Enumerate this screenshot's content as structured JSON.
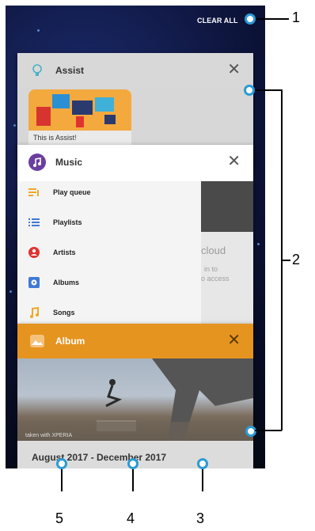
{
  "header": {
    "clear_all_label": "CLEAR ALL"
  },
  "cards": {
    "assist": {
      "title": "Assist",
      "icon": "lightbulb-icon",
      "close_icon": "close-icon",
      "preview_caption": "This is Assist!"
    },
    "music": {
      "title": "Music",
      "icon": "music-note-icon",
      "close_icon": "close-icon",
      "menu": [
        {
          "label": "Play queue",
          "icon": "queue-icon",
          "color": "#f2a626"
        },
        {
          "label": "Playlists",
          "icon": "list-icon",
          "color": "#3f7ad6"
        },
        {
          "label": "Artists",
          "icon": "artist-icon",
          "color": "#e0322f"
        },
        {
          "label": "Albums",
          "icon": "album-icon",
          "color": "#3f7ad6"
        },
        {
          "label": "Songs",
          "icon": "song-icon",
          "color": "#f2a626"
        }
      ],
      "faded_text_1": "cloud",
      "faded_text_2": "in to",
      "faded_text_3": "o access"
    },
    "album": {
      "title": "Album",
      "icon": "photo-icon",
      "close_icon": "close-icon",
      "watermark": "taken with XPERIA",
      "date_range": "August 2017 - December 2017"
    }
  },
  "navbar": {
    "back_icon": "back-triangle-icon",
    "home_icon": "home-circle-icon",
    "recents_icon": "recents-square-icon"
  },
  "callouts": [
    "1",
    "2",
    "3",
    "4",
    "5"
  ],
  "colors": {
    "accent": "#2a9bd6",
    "album_header": "#e69420",
    "music_icon": "#6a3ea1"
  }
}
